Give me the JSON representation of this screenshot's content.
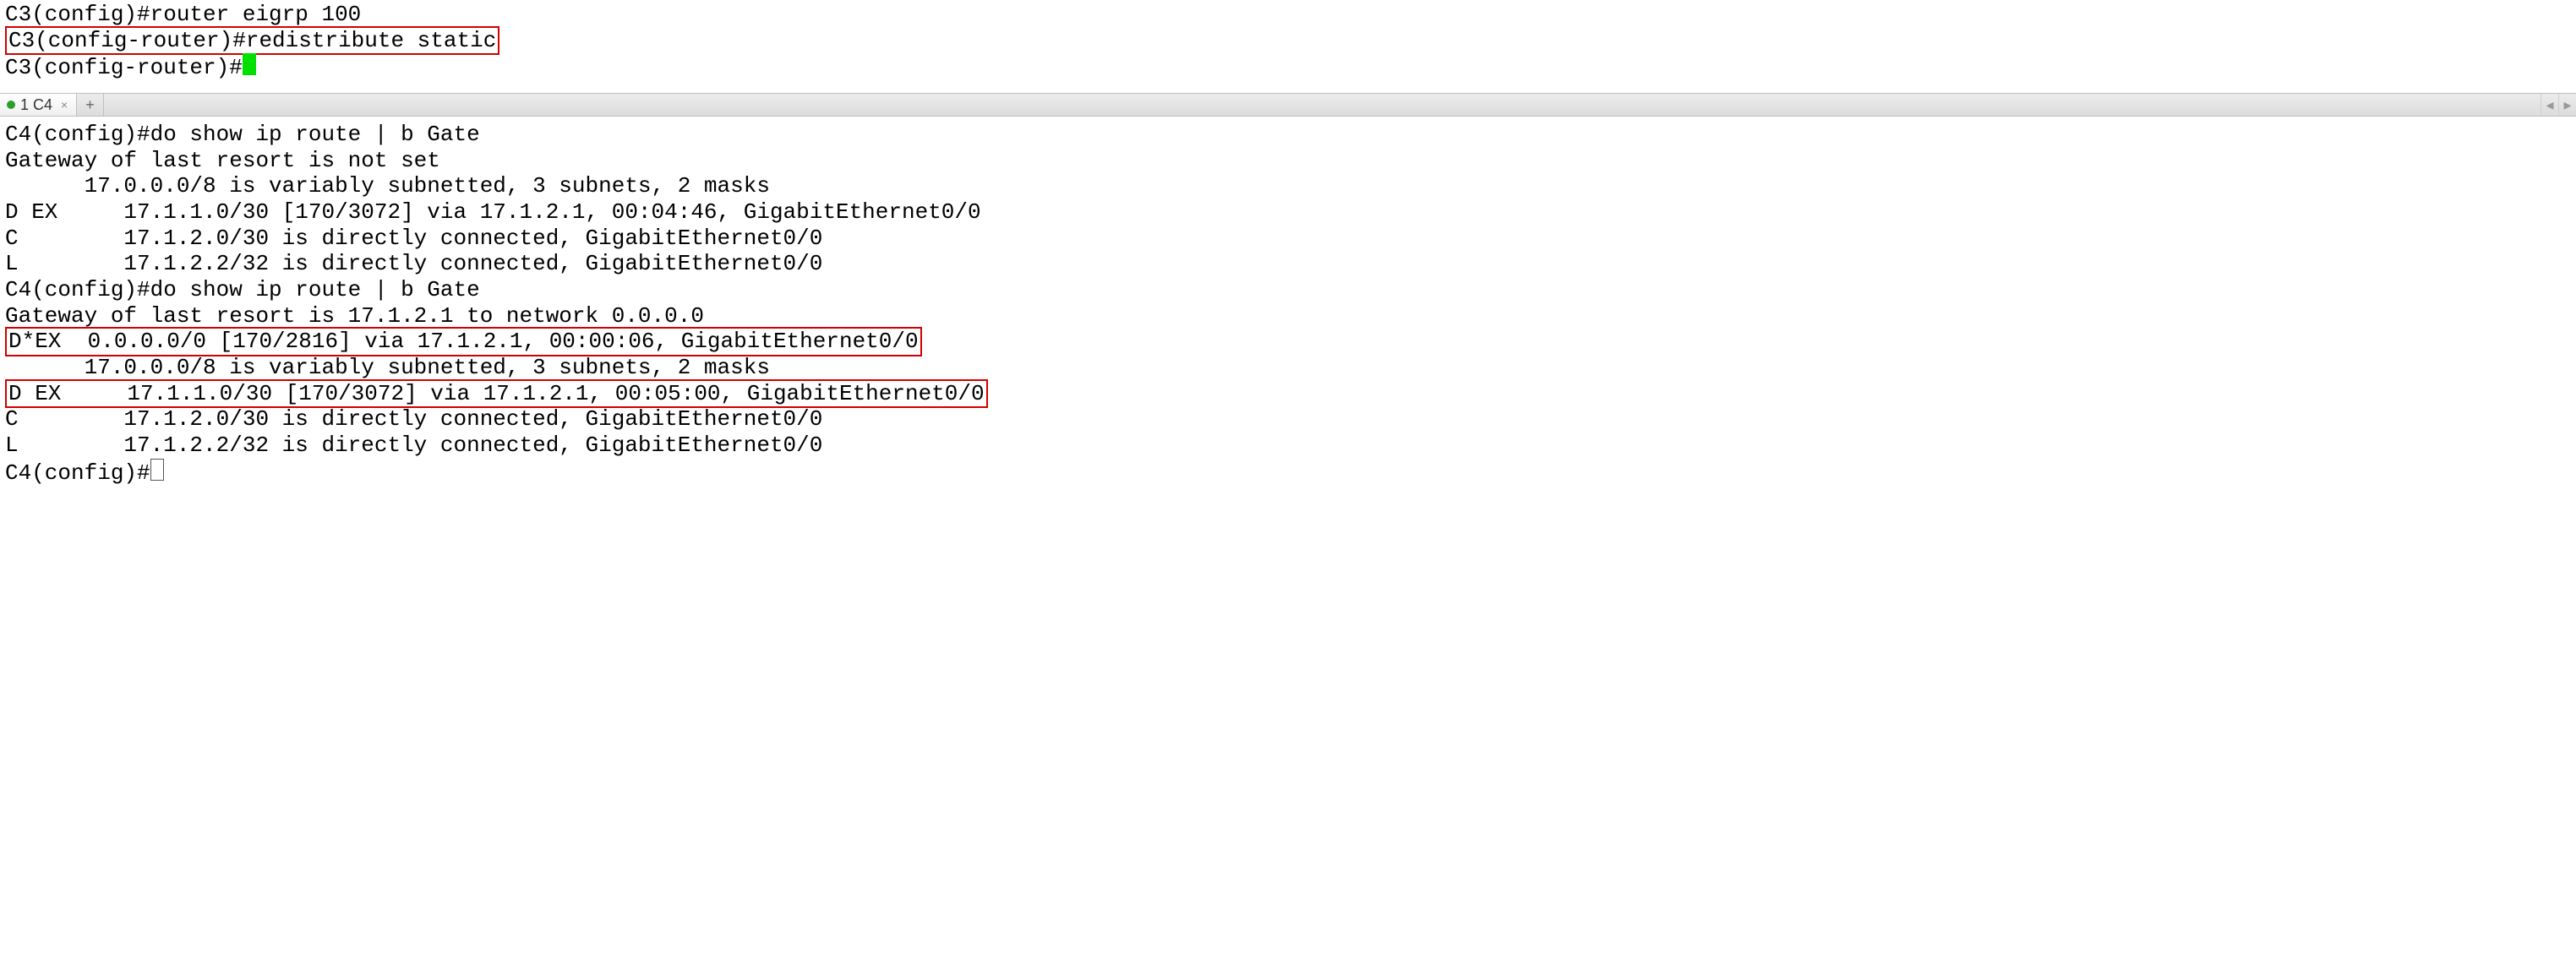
{
  "top_terminal": {
    "lines": [
      {
        "text": "C3(config)#router eigrp 100",
        "highlight": false
      },
      {
        "text": "C3(config-router)#redistribute static",
        "highlight": true
      },
      {
        "text": "C3(config-router)#",
        "highlight": false,
        "cursor": "green"
      }
    ]
  },
  "tabbar": {
    "tabs": [
      {
        "label": "1 C4",
        "active": true,
        "status": "connected"
      }
    ],
    "add_label": "+",
    "scroll_left": "◂",
    "scroll_right": "▸"
  },
  "bottom_terminal": {
    "lines": [
      {
        "text": "C4(config)#do show ip route | b Gate"
      },
      {
        "text": "Gateway of last resort is not set"
      },
      {
        "text": ""
      },
      {
        "text": "      17.0.0.0/8 is variably subnetted, 3 subnets, 2 masks"
      },
      {
        "text": "D EX     17.1.1.0/30 [170/3072] via 17.1.2.1, 00:04:46, GigabitEthernet0/0"
      },
      {
        "text": "C        17.1.2.0/30 is directly connected, GigabitEthernet0/0"
      },
      {
        "text": "L        17.1.2.2/32 is directly connected, GigabitEthernet0/0"
      },
      {
        "text": "C4(config)#do show ip route | b Gate"
      },
      {
        "text": "Gateway of last resort is 17.1.2.1 to network 0.0.0.0"
      },
      {
        "text": ""
      },
      {
        "text": "D*EX  0.0.0.0/0 [170/2816] via 17.1.2.1, 00:00:06, GigabitEthernet0/0",
        "highlight": true
      },
      {
        "text": "      17.0.0.0/8 is variably subnetted, 3 subnets, 2 masks"
      },
      {
        "text": "D EX     17.1.1.0/30 [170/3072] via 17.1.2.1, 00:05:00, GigabitEthernet0/0",
        "highlight": true
      },
      {
        "text": "C        17.1.2.0/30 is directly connected, GigabitEthernet0/0"
      },
      {
        "text": "L        17.1.2.2/32 is directly connected, GigabitEthernet0/0"
      },
      {
        "text": "C4(config)#",
        "cursor": "hollow"
      }
    ]
  }
}
